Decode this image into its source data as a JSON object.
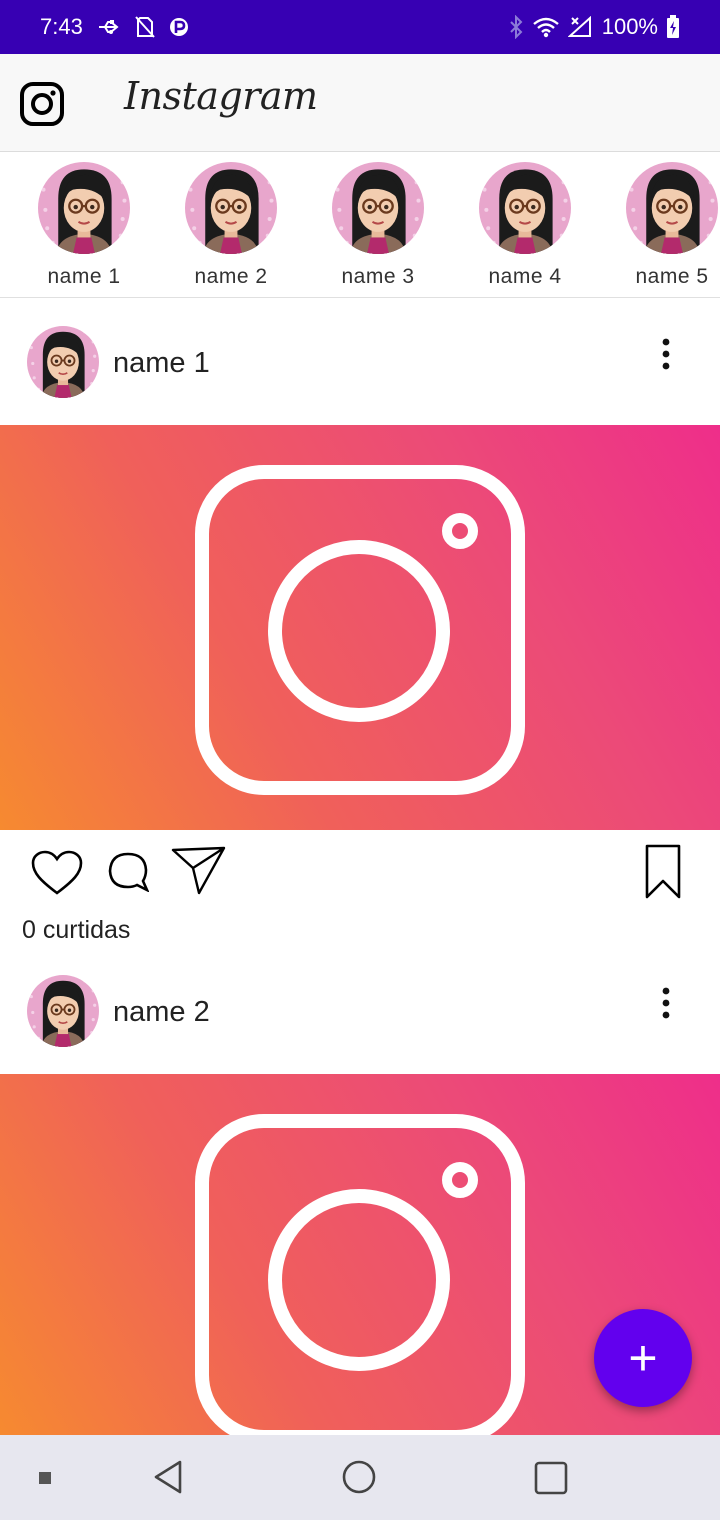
{
  "status_bar": {
    "time": "7:43",
    "battery": "100%",
    "bg_color": "#3700b3"
  },
  "app_bar": {
    "title": "Instagram",
    "logo_icon": "instagram-logo-icon"
  },
  "stories": [
    {
      "name": "name 1"
    },
    {
      "name": "name 2"
    },
    {
      "name": "name 3"
    },
    {
      "name": "name 4"
    },
    {
      "name": "name 5"
    }
  ],
  "posts": [
    {
      "author": "name 1",
      "likes": "0 curtidas",
      "image_icon": "instagram-camera-icon"
    },
    {
      "author": "name 2",
      "image_icon": "instagram-camera-icon"
    }
  ],
  "actions": {
    "like_icon": "heart-icon",
    "comment_icon": "comment-icon",
    "share_icon": "send-icon",
    "save_icon": "bookmark-icon"
  },
  "fab": {
    "label": "+",
    "color": "#6200ee"
  },
  "nav": {
    "back_icon": "back-icon",
    "home_icon": "home-icon",
    "recents_icon": "recents-icon"
  },
  "colors": {
    "gradient_start": "#f68a30",
    "gradient_end": "#ee2e8a"
  }
}
